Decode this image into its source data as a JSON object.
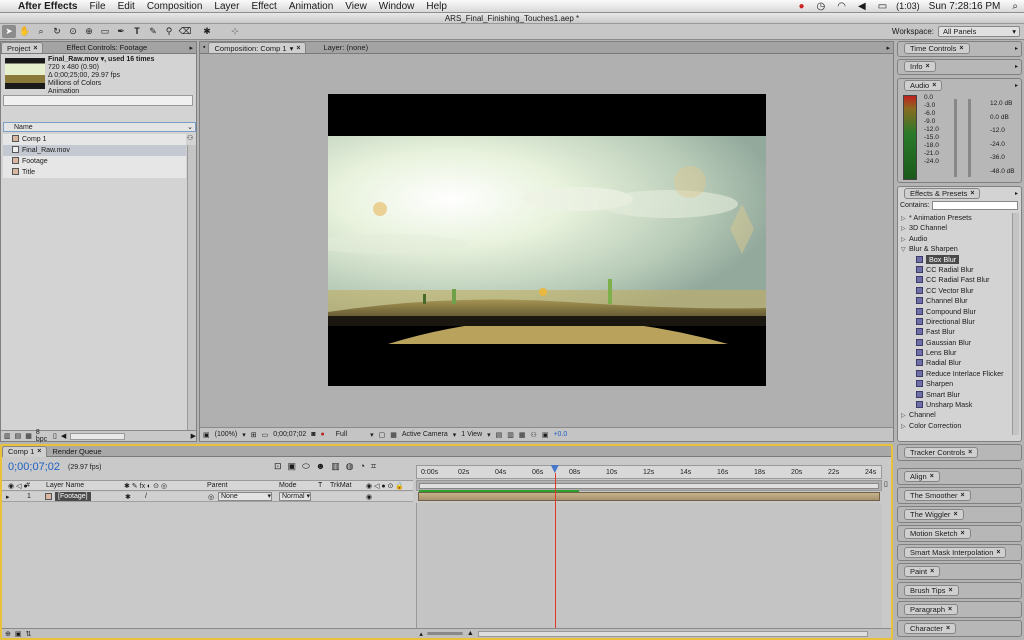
{
  "menubar": {
    "app_name": "After Effects",
    "items": [
      "File",
      "Edit",
      "Composition",
      "Layer",
      "Effect",
      "Animation",
      "View",
      "Window",
      "Help"
    ],
    "battery": "(1:03)",
    "clock": "Sun 7:28:16 PM"
  },
  "window_title": "ARS_Final_Finishing_Touches1.aep *",
  "workspace": {
    "label": "Workspace:",
    "value": "All Panels"
  },
  "project_panel": {
    "tabs": [
      "Project",
      "Effect Controls: Footage"
    ],
    "footage_name": "Final_Raw.mov ▾, used 16 times",
    "footage_info": [
      "720 x 480 (0.90)",
      "Δ 0;00;25;00, 29.97 fps",
      "Millions of Colors",
      "Animation"
    ],
    "column_name": "Name",
    "items": [
      "Comp 1",
      "Final_Raw.mov",
      "Footage",
      "Title"
    ],
    "bpc": "8 bpc"
  },
  "comp_panel": {
    "tab": "Composition: Comp 1",
    "layer_tab": "Layer: (none)",
    "zoom": "(100%)",
    "timecode": "0;00;07;02",
    "resolution": "Full",
    "camera": "Active Camera",
    "view": "1 View",
    "exposure": "+0.0"
  },
  "right_panels": {
    "time_controls": "Time Controls",
    "info": "Info",
    "audio": "Audio",
    "audio_left_scale": [
      "0.0",
      "-3.0",
      "-6.0",
      "-9.0",
      "-12.0",
      "-15.0",
      "-18.0",
      "-21.0",
      "-24.0"
    ],
    "audio_right_scale": [
      "12.0 dB",
      "0.0 dB",
      "-12.0",
      "-24.0",
      "-36.0",
      "-48.0 dB"
    ],
    "effects_presets": "Effects & Presets",
    "contains_label": "Contains:",
    "tree_top": [
      "* Animation Presets",
      "3D Channel",
      "Audio",
      "Blur & Sharpen"
    ],
    "blur_items": [
      "Box Blur",
      "CC Radial Blur",
      "CC Radial Fast Blur",
      "CC Vector Blur",
      "Channel Blur",
      "Compound Blur",
      "Directional Blur",
      "Fast Blur",
      "Gaussian Blur",
      "Lens Blur",
      "Radial Blur",
      "Reduce Interlace Flicker",
      "Sharpen",
      "Smart Blur",
      "Unsharp Mask"
    ],
    "tree_bottom": [
      "Channel",
      "Color Correction"
    ],
    "lower_panels": [
      "Tracker Controls",
      "Align",
      "The Smoother",
      "The Wiggler",
      "Motion Sketch",
      "Smart Mask Interpolation",
      "Paint",
      "Brush Tips",
      "Paragraph",
      "Character"
    ]
  },
  "timeline": {
    "tabs": [
      "Comp 1",
      "Render Queue"
    ],
    "current_time": "0;00;07;02",
    "fps": "(29.97 fps)",
    "headers": {
      "num": "#",
      "layer_name": "Layer Name",
      "parent": "Parent",
      "mode": "Mode",
      "t": "T",
      "trkmat": "TrkMat"
    },
    "layer": {
      "index": "1",
      "name": "[Footage]",
      "parent": "None",
      "mode": "Normal"
    },
    "ruler": [
      "0:00s",
      "02s",
      "04s",
      "06s",
      "08s",
      "10s",
      "12s",
      "14s",
      "16s",
      "18s",
      "20s",
      "22s",
      "24s"
    ],
    "playhead_seconds": 7.07,
    "duration_seconds": 25
  },
  "colors": {
    "accent_blue": "#1f5fc4",
    "playhead": "#e23a2a",
    "highlight_border": "#e8c23a"
  }
}
